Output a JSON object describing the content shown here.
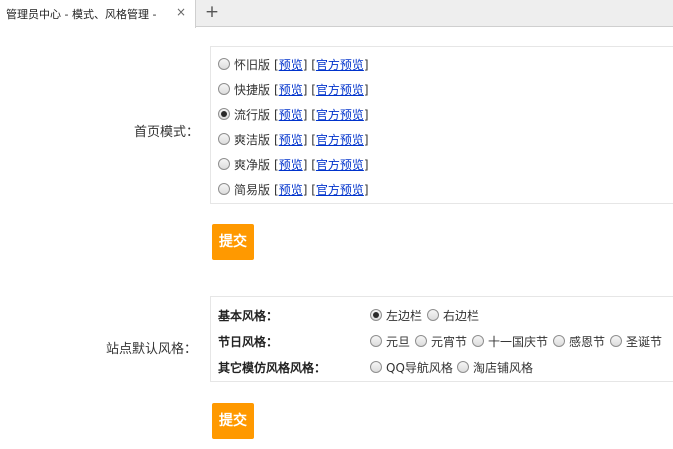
{
  "tab": {
    "title": "管理员中心 - 模式、风格管理 -",
    "close": "×",
    "new_tab": "+"
  },
  "homepage_mode": {
    "label": "首页模式：",
    "preview_label": "预览",
    "official_preview_label": "官方预览",
    "options": [
      {
        "name": "怀旧版",
        "checked": false
      },
      {
        "name": "快捷版",
        "checked": false
      },
      {
        "name": "流行版",
        "checked": true
      },
      {
        "name": "爽洁版",
        "checked": false
      },
      {
        "name": "爽净版",
        "checked": false
      },
      {
        "name": "简易版",
        "checked": false
      }
    ],
    "submit": "提交"
  },
  "site_style": {
    "label": "站点默认风格：",
    "rows": [
      {
        "label": "基本风格：",
        "options": [
          {
            "name": "左边栏",
            "checked": true
          },
          {
            "name": "右边栏",
            "checked": false
          }
        ]
      },
      {
        "label": "节日风格：",
        "options": [
          {
            "name": "元旦",
            "checked": false
          },
          {
            "name": "元宵节",
            "checked": false
          },
          {
            "name": "十一国庆节",
            "checked": false
          },
          {
            "name": "感恩节",
            "checked": false
          },
          {
            "name": "圣诞节",
            "checked": false
          }
        ]
      },
      {
        "label": "其它模仿风格风格：",
        "options": [
          {
            "name": "QQ导航风格",
            "checked": false
          },
          {
            "name": "淘店铺风格",
            "checked": false
          }
        ]
      }
    ],
    "submit": "提交"
  }
}
